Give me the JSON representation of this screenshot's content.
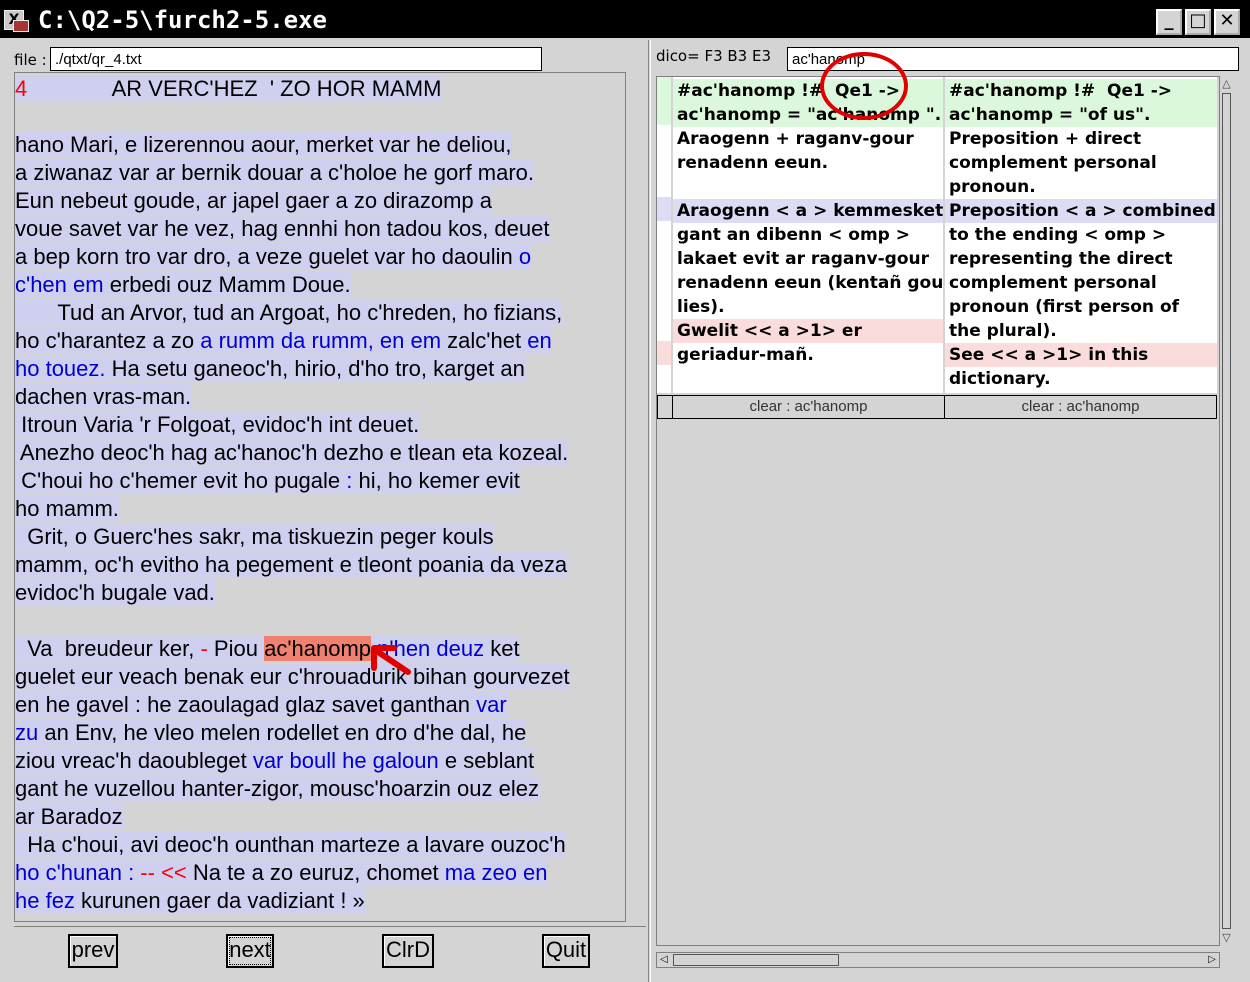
{
  "window": {
    "title": "C:\\Q2-5\\furch2-5.exe"
  },
  "file": {
    "label": "file :",
    "value": "./qtxt/qr_4.txt"
  },
  "dico": {
    "label": "dico= F3  B3  E3",
    "search_value": "ac'hanomp"
  },
  "text_lines": [
    [
      {
        "t": "4",
        "c": "red",
        "h": true
      },
      {
        "t": "              AR VERC'HEZ  ' ZO HOR MAMM",
        "h": true
      }
    ],
    [],
    [
      {
        "t": "hano Mari, e lizerennou aour, merket var he deliou,",
        "h": true
      }
    ],
    [
      {
        "t": "a ziwanaz var ar bernik douar a c'holoe he gorf maro.",
        "h": true
      }
    ],
    [
      {
        "t": "Eun nebeut goude, ar japel gaer a zo dirazomp a",
        "h": true
      }
    ],
    [
      {
        "t": "voue savet var he vez, hag ennhi hon tadou kos, deuet",
        "h": true
      }
    ],
    [
      {
        "t": "a bep korn tro var dro, a veze guelet var ho daoulin ",
        "h": true
      },
      {
        "t": "o",
        "c": "blue",
        "h": true
      }
    ],
    [
      {
        "t": "c'hen em",
        "c": "blue",
        "h": true
      },
      {
        "t": " erbedi ouz Mamm Doue.",
        "h": true
      }
    ],
    [
      {
        "t": "       Tud an Arvor, tud an Argoat, ho c'hreden, ho fizians,",
        "h": true
      }
    ],
    [
      {
        "t": "ho c'harantez a zo ",
        "h": true
      },
      {
        "t": "a rumm da rumm, en em",
        "c": "blue",
        "h": true
      },
      {
        "t": " zalc'het ",
        "h": true
      },
      {
        "t": "en",
        "c": "blue",
        "h": true
      }
    ],
    [
      {
        "t": "ho touez.",
        "c": "blue",
        "h": true
      },
      {
        "t": " Ha setu ganeoc'h, hirio, d'ho tro, karget an",
        "h": true
      }
    ],
    [
      {
        "t": "dachen vras-man.",
        "h": true
      }
    ],
    [
      {
        "t": " Itroun Varia 'r Folgoat, evidoc'h int deuet.",
        "h": true
      }
    ],
    [
      {
        "t": " Anezho deoc'h hag ac'hanoc'h dezho e tlean eta kozeal.",
        "h": true
      }
    ],
    [
      {
        "t": " C'houi ho c'hemer evit ho pugale ",
        "h": true
      },
      {
        "t": ":",
        "c": "blue",
        "h": true
      },
      {
        "t": " hi, ho kemer evit",
        "h": true
      }
    ],
    [
      {
        "t": "ho mamm.",
        "h": true
      }
    ],
    [
      {
        "t": "  Grit, o Guerc'hes sakr, ma tiskuezin peger kouls",
        "h": true
      }
    ],
    [
      {
        "t": "mamm, oc'h evitho ha pegement e tleont poania da veza",
        "h": true
      }
    ],
    [
      {
        "t": "evidoc'h bugale vad.",
        "h": true
      }
    ],
    [],
    [
      {
        "t": "  Va  breudeur ker, ",
        "h": true
      },
      {
        "t": "-",
        "c": "red",
        "h": true
      },
      {
        "t": " Piou ",
        "h": true
      },
      {
        "t": "ac'hanomp",
        "s": true
      },
      {
        "t": " n'hen deuz",
        "c": "blue",
        "h": true
      },
      {
        "t": " ket",
        "h": true
      }
    ],
    [
      {
        "t": "guelet eur veach benak eur c'hrouadurik bihan gourvezet",
        "h": true
      }
    ],
    [
      {
        "t": "en he gavel : he zaoulagad glaz savet ganthan ",
        "h": true
      },
      {
        "t": "var",
        "c": "blue",
        "h": true
      }
    ],
    [
      {
        "t": "zu",
        "c": "blue",
        "h": true
      },
      {
        "t": " an Env, he vleo melen rodellet en dro d'he dal, he",
        "h": true
      }
    ],
    [
      {
        "t": "ziou vreac'h daoubleget ",
        "h": true
      },
      {
        "t": "var boull he galoun",
        "c": "blue",
        "h": true
      },
      {
        "t": " e seblant",
        "h": true
      }
    ],
    [
      {
        "t": "gant he vuzellou hanter-zigor, mousc'hoarzin ouz elez",
        "h": true
      }
    ],
    [
      {
        "t": "ar Baradoz",
        "h": true
      }
    ],
    [
      {
        "t": "  Ha c'houi, avi deoc'h ounthan marteze a lavare ouzoc'h",
        "h": true
      }
    ],
    [
      {
        "t": "ho c'hunan :",
        "c": "blue",
        "h": true
      },
      {
        "t": " -- <<",
        "c": "red",
        "h": true
      },
      {
        "t": " Na te a zo euruz, chomet ",
        "h": true
      },
      {
        "t": "ma zeo en",
        "c": "blue",
        "h": true
      }
    ],
    [
      {
        "t": "he fez",
        "c": "blue",
        "h": true
      },
      {
        "t": " kurunen gaer da vadiziant ! »",
        "h": true
      }
    ]
  ],
  "dict": {
    "col1_lines": [
      {
        "t": "#ac'hanomp !#  Qe1 ->",
        "bg": "green"
      },
      {
        "t": "ac'hanomp = \"ac'hanomp \".",
        "bg": "green"
      },
      {
        "t": "Araogenn + raganv-gour",
        "bg": "white"
      },
      {
        "t": "renadenn eeun.",
        "bg": "white"
      },
      {
        "t": "",
        "bg": "white"
      },
      {
        "t": "Araogenn < a > kemmesket",
        "bg": "blue"
      },
      {
        "t": "gant an dibenn < omp >",
        "bg": "white"
      },
      {
        "t": "lakaet evit ar raganv-gour",
        "bg": "white"
      },
      {
        "t": "renadenn eeun (kentañ gour",
        "bg": "white"
      },
      {
        "t": "lies).",
        "bg": "white"
      },
      {
        "t": "Gwelit << a >1> er",
        "bg": "pink"
      },
      {
        "t": "geriadur-mañ.",
        "bg": "white"
      },
      {
        "t": "",
        "bg": "white"
      }
    ],
    "col2_lines": [
      {
        "t": "#ac'hanomp !#  Qe1 ->",
        "bg": "green"
      },
      {
        "t": "ac'hanomp = \"of us\".",
        "bg": "green"
      },
      {
        "t": "Preposition + direct",
        "bg": "white"
      },
      {
        "t": "complement personal",
        "bg": "white"
      },
      {
        "t": "pronoun.",
        "bg": "white"
      },
      {
        "t": "Preposition < a > combined",
        "bg": "blue"
      },
      {
        "t": "to the ending < omp >",
        "bg": "white"
      },
      {
        "t": "representing the direct",
        "bg": "white"
      },
      {
        "t": "complement personal",
        "bg": "white"
      },
      {
        "t": "pronoun (first person of",
        "bg": "white"
      },
      {
        "t": "the plural).",
        "bg": "white"
      },
      {
        "t": "See << a >1> in this",
        "bg": "pink"
      },
      {
        "t": "dictionary.",
        "bg": "white"
      }
    ],
    "col1_clear": "clear : ac'hanomp",
    "col2_clear": "clear : ac'hanomp"
  },
  "buttons": {
    "prev": "prev",
    "next": "next",
    "clrd": "ClrD",
    "quit": "Quit"
  },
  "window_buttons": {
    "minimize": "_",
    "maximize": "□",
    "close": "✕"
  },
  "colors": {
    "highlight": "#cfcff0",
    "link_blue": "#0000cc",
    "marker_red": "#ff0000",
    "selected_word": "#f08070",
    "annotation_red": "#e00000"
  }
}
